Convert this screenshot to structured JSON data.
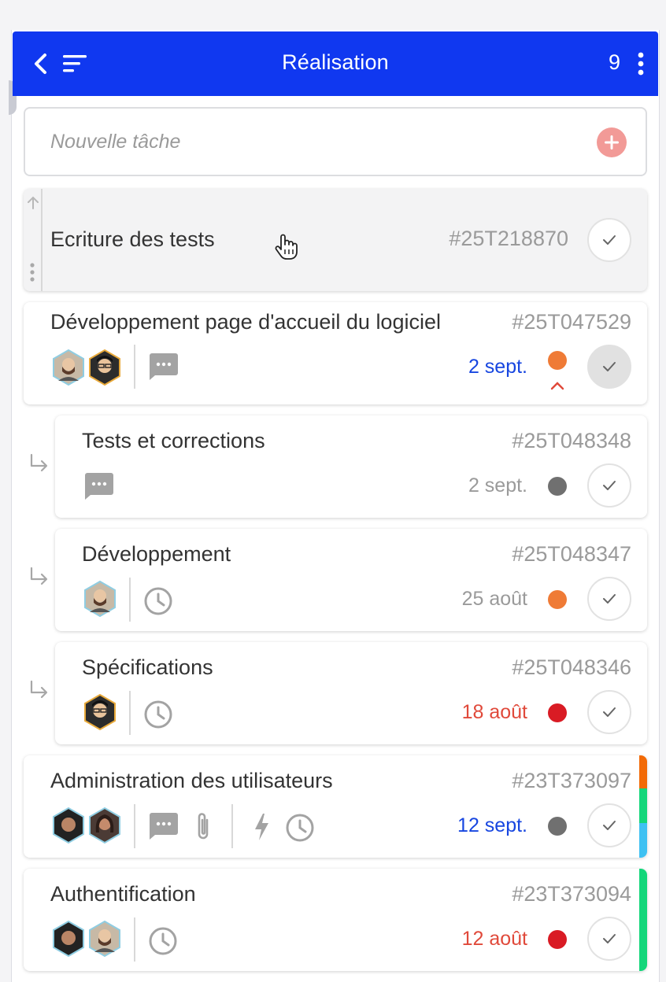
{
  "header": {
    "title": "Réalisation",
    "count": "9",
    "color": "#1038f0"
  },
  "new_task": {
    "placeholder": "Nouvelle tâche",
    "add_button_color": "#f29a97"
  },
  "colors": {
    "blue_date": "#1746e0",
    "red_date": "#e0493a",
    "grey_date": "#9a9a9a",
    "orange": "#ef7b36",
    "grey_dot": "#707070",
    "red_dot": "#d91b24",
    "strip_orange": "#f26a06",
    "strip_green": "#13d67a",
    "strip_blue": "#3ec1f2"
  },
  "tasks": [
    {
      "title": "Ecriture des tests",
      "ref": "#25T218870",
      "state": "dragging",
      "icons": [
        "drag-up-arrow-icon",
        "drag-handle-icon",
        "hand-cursor-icon"
      ]
    },
    {
      "title": "Développement page d'accueil du logiciel",
      "ref": "#25T047529",
      "date": "2 sept.",
      "date_color": "blue",
      "dot": "orange",
      "collapse_icon": "chevron-up-icon",
      "avatars": [
        "avatar-man-beard",
        "avatar-man-glasses"
      ],
      "icons": [
        "comment-icon"
      ],
      "check_filled": true
    },
    {
      "title": "Tests et corrections",
      "ref": "#25T048348",
      "date": "2 sept.",
      "date_color": "grey",
      "dot": "grey",
      "subtask": true,
      "icons": [
        "comment-icon"
      ]
    },
    {
      "title": "Développement",
      "ref": "#25T048347",
      "date": "25 août",
      "date_color": "grey",
      "dot": "orange",
      "subtask": true,
      "avatars": [
        "avatar-man-beard"
      ],
      "icons": [
        "clock-icon"
      ]
    },
    {
      "title": "Spécifications",
      "ref": "#25T048346",
      "date": "18 août",
      "date_color": "red",
      "dot": "red",
      "subtask": true,
      "avatars": [
        "avatar-man-glasses"
      ],
      "icons": [
        "clock-icon"
      ]
    },
    {
      "title": "Administration des utilisateurs",
      "ref": "#23T373097",
      "date": "12 sept.",
      "date_color": "blue",
      "dot": "grey",
      "avatars": [
        "avatar-man-curly",
        "avatar-woman"
      ],
      "icons": [
        "comment-icon",
        "paperclip-icon",
        "lightning-icon",
        "clock-icon"
      ],
      "strips": [
        "orange",
        "green",
        "blue"
      ]
    },
    {
      "title": "Authentification",
      "ref": "#23T373094",
      "date": "12 août",
      "date_color": "red",
      "dot": "red",
      "avatars": [
        "avatar-man-curly",
        "avatar-man-beard"
      ],
      "icons": [
        "clock-icon"
      ],
      "strips": [
        "green"
      ]
    }
  ]
}
